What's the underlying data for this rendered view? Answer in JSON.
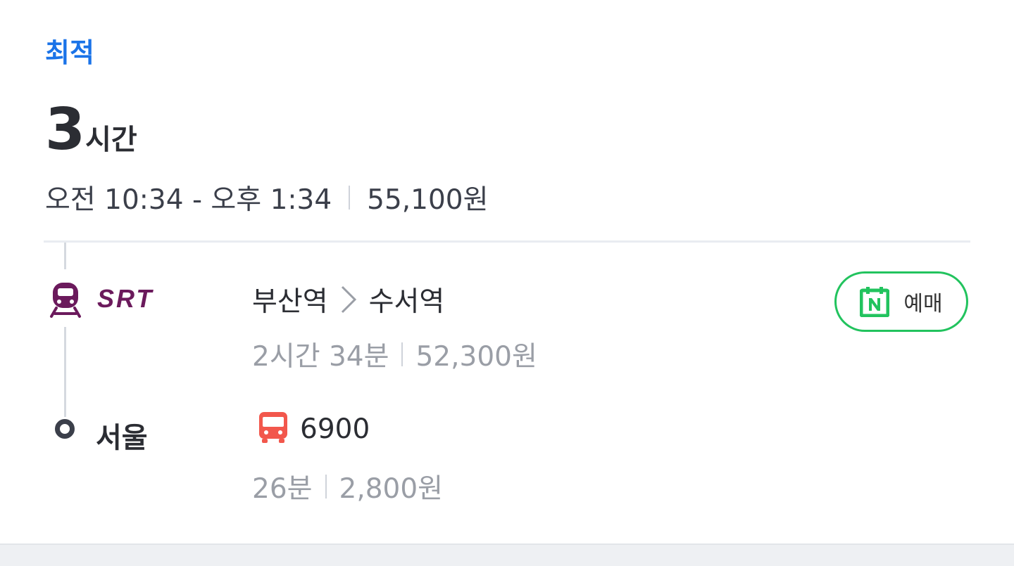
{
  "header": {
    "badge": "최적",
    "duration_number": "3",
    "duration_unit": "시간",
    "time_range": "오전 10:34 - 오후 1:34",
    "total_fare": "55,100원"
  },
  "segments": {
    "train": {
      "icon": "train-icon",
      "logo_text": "SRT",
      "from": "부산역",
      "to": "수서역",
      "duration": "2시간 34분",
      "fare": "52,300원",
      "book_label": "예매",
      "book_icon": "naver-calendar-icon"
    },
    "bus": {
      "stop_name": "서울",
      "icon": "bus-icon",
      "route_no": "6900",
      "duration": "26분",
      "fare": "2,800원"
    }
  },
  "colors": {
    "accent": "#1a73e8",
    "srt": "#6b1a5c",
    "naver_green": "#22c35e",
    "bus_red": "#f2574c"
  }
}
